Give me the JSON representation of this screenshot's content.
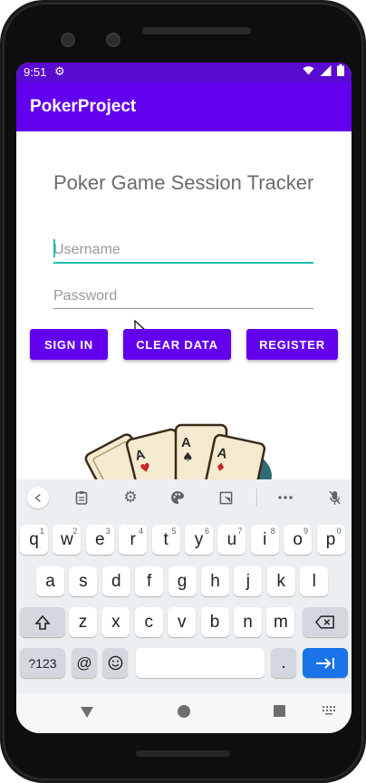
{
  "status_bar": {
    "time": "9:51",
    "settings_icon": "gear-icon",
    "wifi_icon": "wifi-icon",
    "signal_icon": "signal-icon",
    "battery_icon": "battery-icon"
  },
  "app_bar": {
    "title": "PokerProject"
  },
  "main": {
    "heading": "Poker Game Session Tracker",
    "username_placeholder": "Username",
    "password_placeholder": "Password",
    "buttons": {
      "sign_in": "SIGN IN",
      "clear_data": "CLEAR DATA",
      "register": "REGISTER"
    }
  },
  "keyboard": {
    "toolbar_icons": [
      "back-icon",
      "clipboard-icon",
      "gear-icon",
      "palette-icon",
      "resize-icon",
      "more-icon",
      "mic-off-icon"
    ],
    "row1": [
      {
        "k": "q",
        "h": "1"
      },
      {
        "k": "w",
        "h": "2"
      },
      {
        "k": "e",
        "h": "3"
      },
      {
        "k": "r",
        "h": "4"
      },
      {
        "k": "t",
        "h": "5"
      },
      {
        "k": "y",
        "h": "6"
      },
      {
        "k": "u",
        "h": "7"
      },
      {
        "k": "i",
        "h": "8"
      },
      {
        "k": "o",
        "h": "9"
      },
      {
        "k": "p",
        "h": "0"
      }
    ],
    "row2": [
      "a",
      "s",
      "d",
      "f",
      "g",
      "h",
      "j",
      "k",
      "l"
    ],
    "row3": [
      "z",
      "x",
      "c",
      "v",
      "b",
      "n",
      "m"
    ],
    "row4": {
      "symbols": "?123",
      "at": "@",
      "period": "."
    }
  },
  "colors": {
    "primary": "#6200ee",
    "status": "#5a0bd1",
    "accent": "#1fbfb3",
    "enter": "#1a73e8"
  }
}
